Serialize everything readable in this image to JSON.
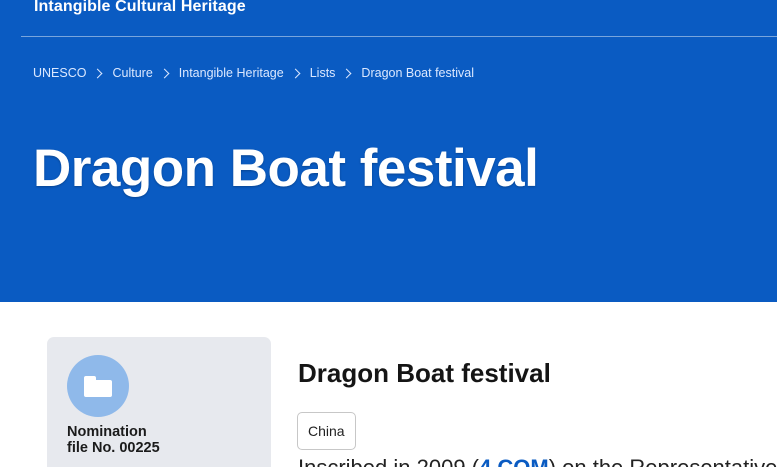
{
  "header": {
    "site_name": "Intangible Cultural Heritage"
  },
  "breadcrumb": [
    {
      "label": "UNESCO"
    },
    {
      "label": "Culture"
    },
    {
      "label": "Intangible Heritage"
    },
    {
      "label": "Lists"
    },
    {
      "label": "Dragon Boat festival"
    }
  ],
  "hero": {
    "title": "Dragon Boat festival"
  },
  "card": {
    "icon": "folder-icon",
    "nomination_line1": "Nomination",
    "nomination_line2": "file No. 00225"
  },
  "main": {
    "title": "Dragon Boat festival",
    "country_tag": "China",
    "body_text_start": "Inscribed in 2009 (",
    "body_text_link": "4.COM",
    "body_text_end": ") on the Representative"
  },
  "colors": {
    "brand_blue": "#0a5bc2",
    "card_bg": "#e7e9ee",
    "icon_circle": "#8fb9ea"
  }
}
